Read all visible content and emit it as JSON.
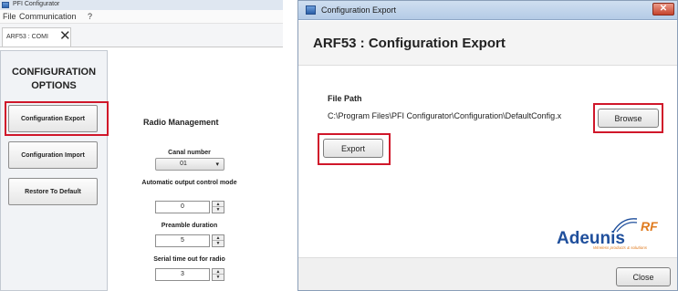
{
  "left_window": {
    "title": "PFI Configurator",
    "menu": [
      "File",
      "Communication",
      "?"
    ],
    "tab": {
      "label": "ARF53 : COMI"
    },
    "config_panel": {
      "title": "CONFIGURATION OPTIONS",
      "buttons": [
        {
          "label": "Configuration Export"
        },
        {
          "label": "Configuration Import"
        },
        {
          "label": "Restore To Default"
        }
      ]
    },
    "radio": {
      "title": "Radio Management",
      "fields": [
        {
          "label": "Canal number",
          "value": "01",
          "kind": "select"
        },
        {
          "label": "Automatic output control mode",
          "value": "0",
          "kind": "spinner"
        },
        {
          "label": "Preamble duration",
          "value": "5",
          "kind": "spinner"
        },
        {
          "label": "Serial time out for radio",
          "value": "3",
          "kind": "spinner"
        }
      ]
    }
  },
  "right_window": {
    "title": "Configuration Export",
    "header": "ARF53 : Configuration Export",
    "file_path": {
      "label": "File Path",
      "value": "C:\\Program Files\\PFI Configurator\\Configuration\\DefaultConfig.x"
    },
    "browse_label": "Browse",
    "export_label": "Export",
    "close_label": "Close",
    "logo": {
      "brand": "Adeunis",
      "suffix": "RF",
      "tagline": "Wireless products & solutions"
    }
  },
  "colors": {
    "highlight": "#d0172a",
    "logo_blue": "#1f4f9c",
    "logo_orange": "#e07b1f"
  },
  "icons": [
    "app-icon",
    "close-x-icon",
    "caret-down-icon",
    "spin-up-icon",
    "spin-down-icon",
    "window-close-icon"
  ]
}
